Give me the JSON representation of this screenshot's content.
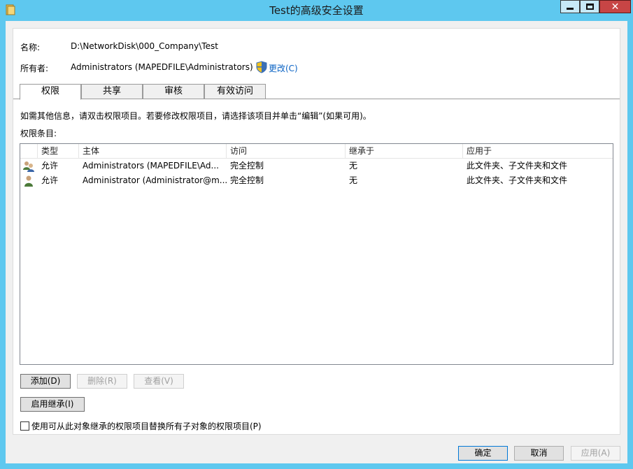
{
  "window": {
    "title": "Test的高级安全设置",
    "close_glyph": "✕"
  },
  "info": {
    "name_label": "名称:",
    "name_value": "D:\\NetworkDisk\\000_Company\\Test",
    "owner_label": "所有者:",
    "owner_value": "Administrators (MAPEDFILE\\Administrators)",
    "change_link": "更改(C)"
  },
  "tabs": [
    {
      "label": "权限",
      "active": true
    },
    {
      "label": "共享",
      "active": false
    },
    {
      "label": "审核",
      "active": false
    },
    {
      "label": "有效访问",
      "active": false
    }
  ],
  "instructions": "如需其他信息，请双击权限项目。若要修改权限项目，请选择该项目并单击“编辑”(如果可用)。",
  "entries_label": "权限条目:",
  "columns": [
    "类型",
    "主体",
    "访问",
    "继承于",
    "应用于"
  ],
  "rows": [
    {
      "icon": "user-group-icon",
      "type": "允许",
      "principal": "Administrators (MAPEDFILE\\Ad...",
      "access": "完全控制",
      "inherited": "无",
      "applies": "此文件夹、子文件夹和文件"
    },
    {
      "icon": "user-icon",
      "type": "允许",
      "principal": "Administrator (Administrator@m...",
      "access": "完全控制",
      "inherited": "无",
      "applies": "此文件夹、子文件夹和文件"
    }
  ],
  "buttons": {
    "add": "添加(D)",
    "remove": "删除(R)",
    "view": "查看(V)",
    "enable_inheritance": "启用继承(I)",
    "ok": "确定",
    "cancel": "取消",
    "apply": "应用(A)"
  },
  "replace_checkbox": {
    "label": "使用可从此对象继承的权限项目替换所有子对象的权限项目(P)",
    "checked": false
  },
  "colors": {
    "window_frame": "#5ec8ef",
    "link": "#0b63c4"
  }
}
